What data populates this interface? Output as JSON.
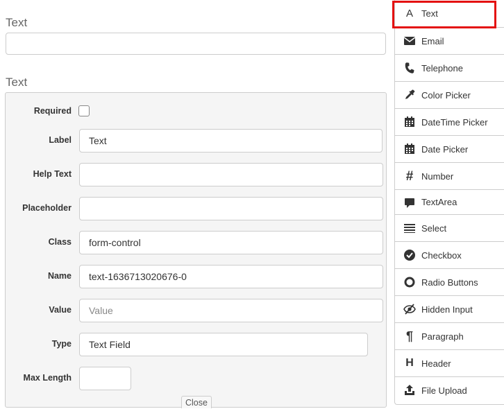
{
  "stage": {
    "preview_label": "Text",
    "edit_label": "Text"
  },
  "editor": {
    "required_label": "Required",
    "label_label": "Label",
    "label_value": "Text",
    "help_label": "Help Text",
    "help_value": "",
    "placeholder_label": "Placeholder",
    "placeholder_value": "",
    "class_label": "Class",
    "class_value": "form-control",
    "name_label": "Name",
    "name_value": "text-1636713020676-0",
    "value_label": "Value",
    "value_placeholder": "Value",
    "type_label": "Type",
    "type_value": "Text Field",
    "maxlength_label": "Max Length",
    "maxlength_value": "",
    "close_label": "Close"
  },
  "sidebar": {
    "items": [
      {
        "label": "Text",
        "icon": "text-icon"
      },
      {
        "label": "Email",
        "icon": "envelope-icon"
      },
      {
        "label": "Telephone",
        "icon": "phone-icon"
      },
      {
        "label": "Color Picker",
        "icon": "eyedropper-icon"
      },
      {
        "label": "DateTime Picker",
        "icon": "calendar-icon"
      },
      {
        "label": "Date Picker",
        "icon": "calendar-icon"
      },
      {
        "label": "Number",
        "icon": "hash-icon"
      },
      {
        "label": "TextArea",
        "icon": "comment-icon"
      },
      {
        "label": "Select",
        "icon": "list-icon"
      },
      {
        "label": "Checkbox",
        "icon": "check-circle-icon"
      },
      {
        "label": "Radio Buttons",
        "icon": "radio-icon"
      },
      {
        "label": "Hidden Input",
        "icon": "eye-slash-icon"
      },
      {
        "label": "Paragraph",
        "icon": "paragraph-icon"
      },
      {
        "label": "Header",
        "icon": "header-icon"
      },
      {
        "label": "File Upload",
        "icon": "upload-icon"
      }
    ]
  }
}
